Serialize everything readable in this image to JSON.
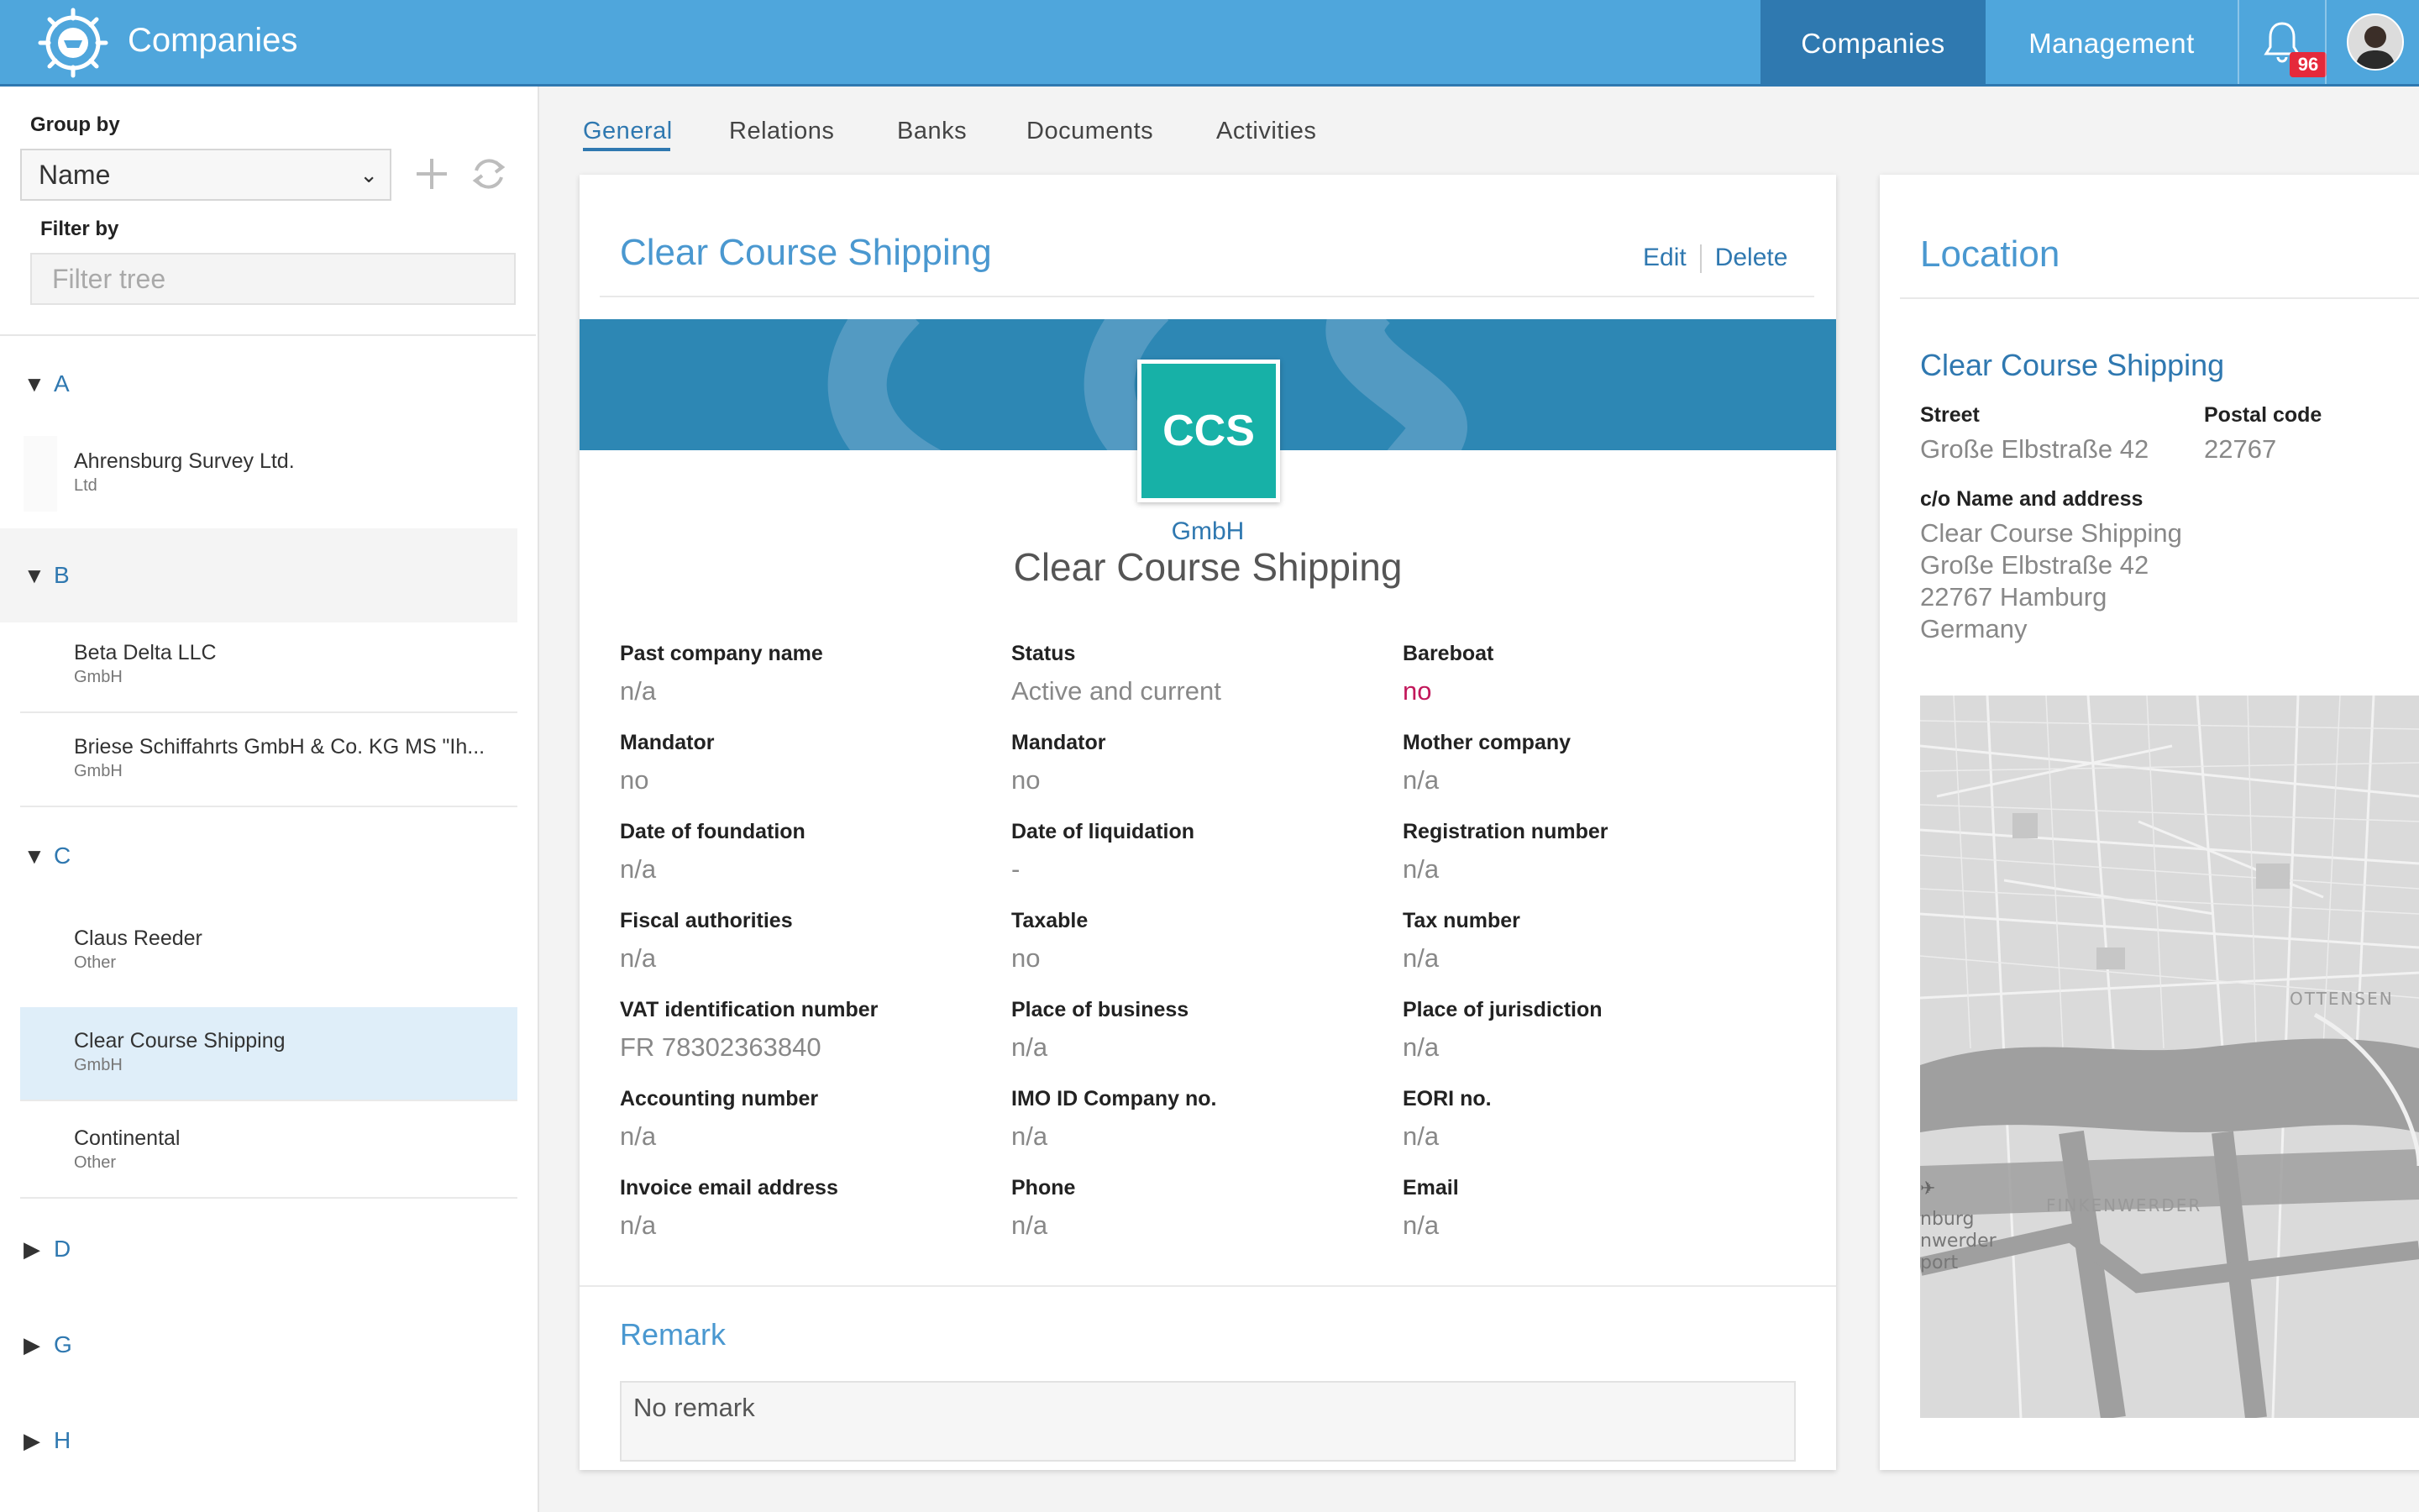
{
  "header": {
    "title": "Companies",
    "nav": [
      {
        "label": "Companies",
        "active": true
      },
      {
        "label": "Management",
        "active": false
      }
    ],
    "notification_count": "96",
    "colors": {
      "bar": "#4fa6dc",
      "active_nav": "#2f79b0",
      "badge": "#e5293b"
    }
  },
  "sidebar": {
    "group_by_label": "Group by",
    "group_by_value": "Name",
    "filter_label": "Filter by",
    "filter_placeholder": "Filter tree",
    "groups": [
      {
        "letter": "A",
        "expanded": true
      },
      {
        "letter": "B",
        "expanded": true
      },
      {
        "letter": "C",
        "expanded": true
      },
      {
        "letter": "D",
        "expanded": false
      },
      {
        "letter": "G",
        "expanded": false
      },
      {
        "letter": "H",
        "expanded": false
      }
    ],
    "items": [
      {
        "name": "Ahrensburg Survey Ltd.",
        "type": "Ltd"
      },
      {
        "name": "Beta Delta LLC",
        "type": "GmbH"
      },
      {
        "name": "Briese Schiffahrts GmbH & Co. KG MS \"Ih...",
        "type": "GmbH"
      },
      {
        "name": "Claus Reeder",
        "type": "Other"
      },
      {
        "name": "Clear Course Shipping",
        "type": "GmbH",
        "selected": true
      },
      {
        "name": "Continental",
        "type": "Other"
      }
    ]
  },
  "tabs": [
    {
      "label": "General",
      "active": true
    },
    {
      "label": "Relations"
    },
    {
      "label": "Banks"
    },
    {
      "label": "Documents"
    },
    {
      "label": "Activities"
    }
  ],
  "company": {
    "title": "Clear Course Shipping",
    "edit_label": "Edit",
    "delete_label": "Delete",
    "logo_text": "CCS",
    "legal_form": "GmbH",
    "name": "Clear Course Shipping",
    "fields": [
      {
        "label": "Past company name",
        "value": "n/a"
      },
      {
        "label": "Status",
        "value": "Active and current"
      },
      {
        "label": "Bareboat",
        "value": "no"
      },
      {
        "label": "Mandator",
        "value": "no"
      },
      {
        "label": "Mandator",
        "value": "no"
      },
      {
        "label": "Mother company",
        "value": "n/a"
      },
      {
        "label": "Date of foundation",
        "value": "n/a"
      },
      {
        "label": "Date of liquidation",
        "value": "-"
      },
      {
        "label": "Registration number",
        "value": "n/a"
      },
      {
        "label": "Fiscal authorities",
        "value": "n/a"
      },
      {
        "label": "Taxable",
        "value": "no"
      },
      {
        "label": "Tax number",
        "value": "n/a"
      },
      {
        "label": "VAT identification number",
        "value": "FR 78302363840"
      },
      {
        "label": "Place of business",
        "value": "n/a"
      },
      {
        "label": "Place of jurisdiction",
        "value": "n/a"
      },
      {
        "label": "Accounting number",
        "value": "n/a"
      },
      {
        "label": "IMO ID Company no.",
        "value": "n/a"
      },
      {
        "label": "EORI no.",
        "value": "n/a"
      },
      {
        "label": "Invoice email address",
        "value": "n/a"
      },
      {
        "label": "Phone",
        "value": "n/a"
      },
      {
        "label": "Email",
        "value": "n/a"
      }
    ],
    "remark_title": "Remark",
    "remark_text": "No remark"
  },
  "location": {
    "title": "Location",
    "name": "Clear Course Shipping",
    "street_label": "Street",
    "street": "Große Elbstraße 42",
    "postal_label": "Postal code",
    "postal": "22767",
    "co_label": "c/o Name and address",
    "co_lines": [
      "Clear Course Shipping",
      "Große Elbstraße 42",
      "22767 Hamburg",
      "Germany"
    ],
    "map_labels": [
      "OTTENSEN",
      "FINKENWERDER",
      "nburg",
      "nwerder",
      "port"
    ]
  }
}
